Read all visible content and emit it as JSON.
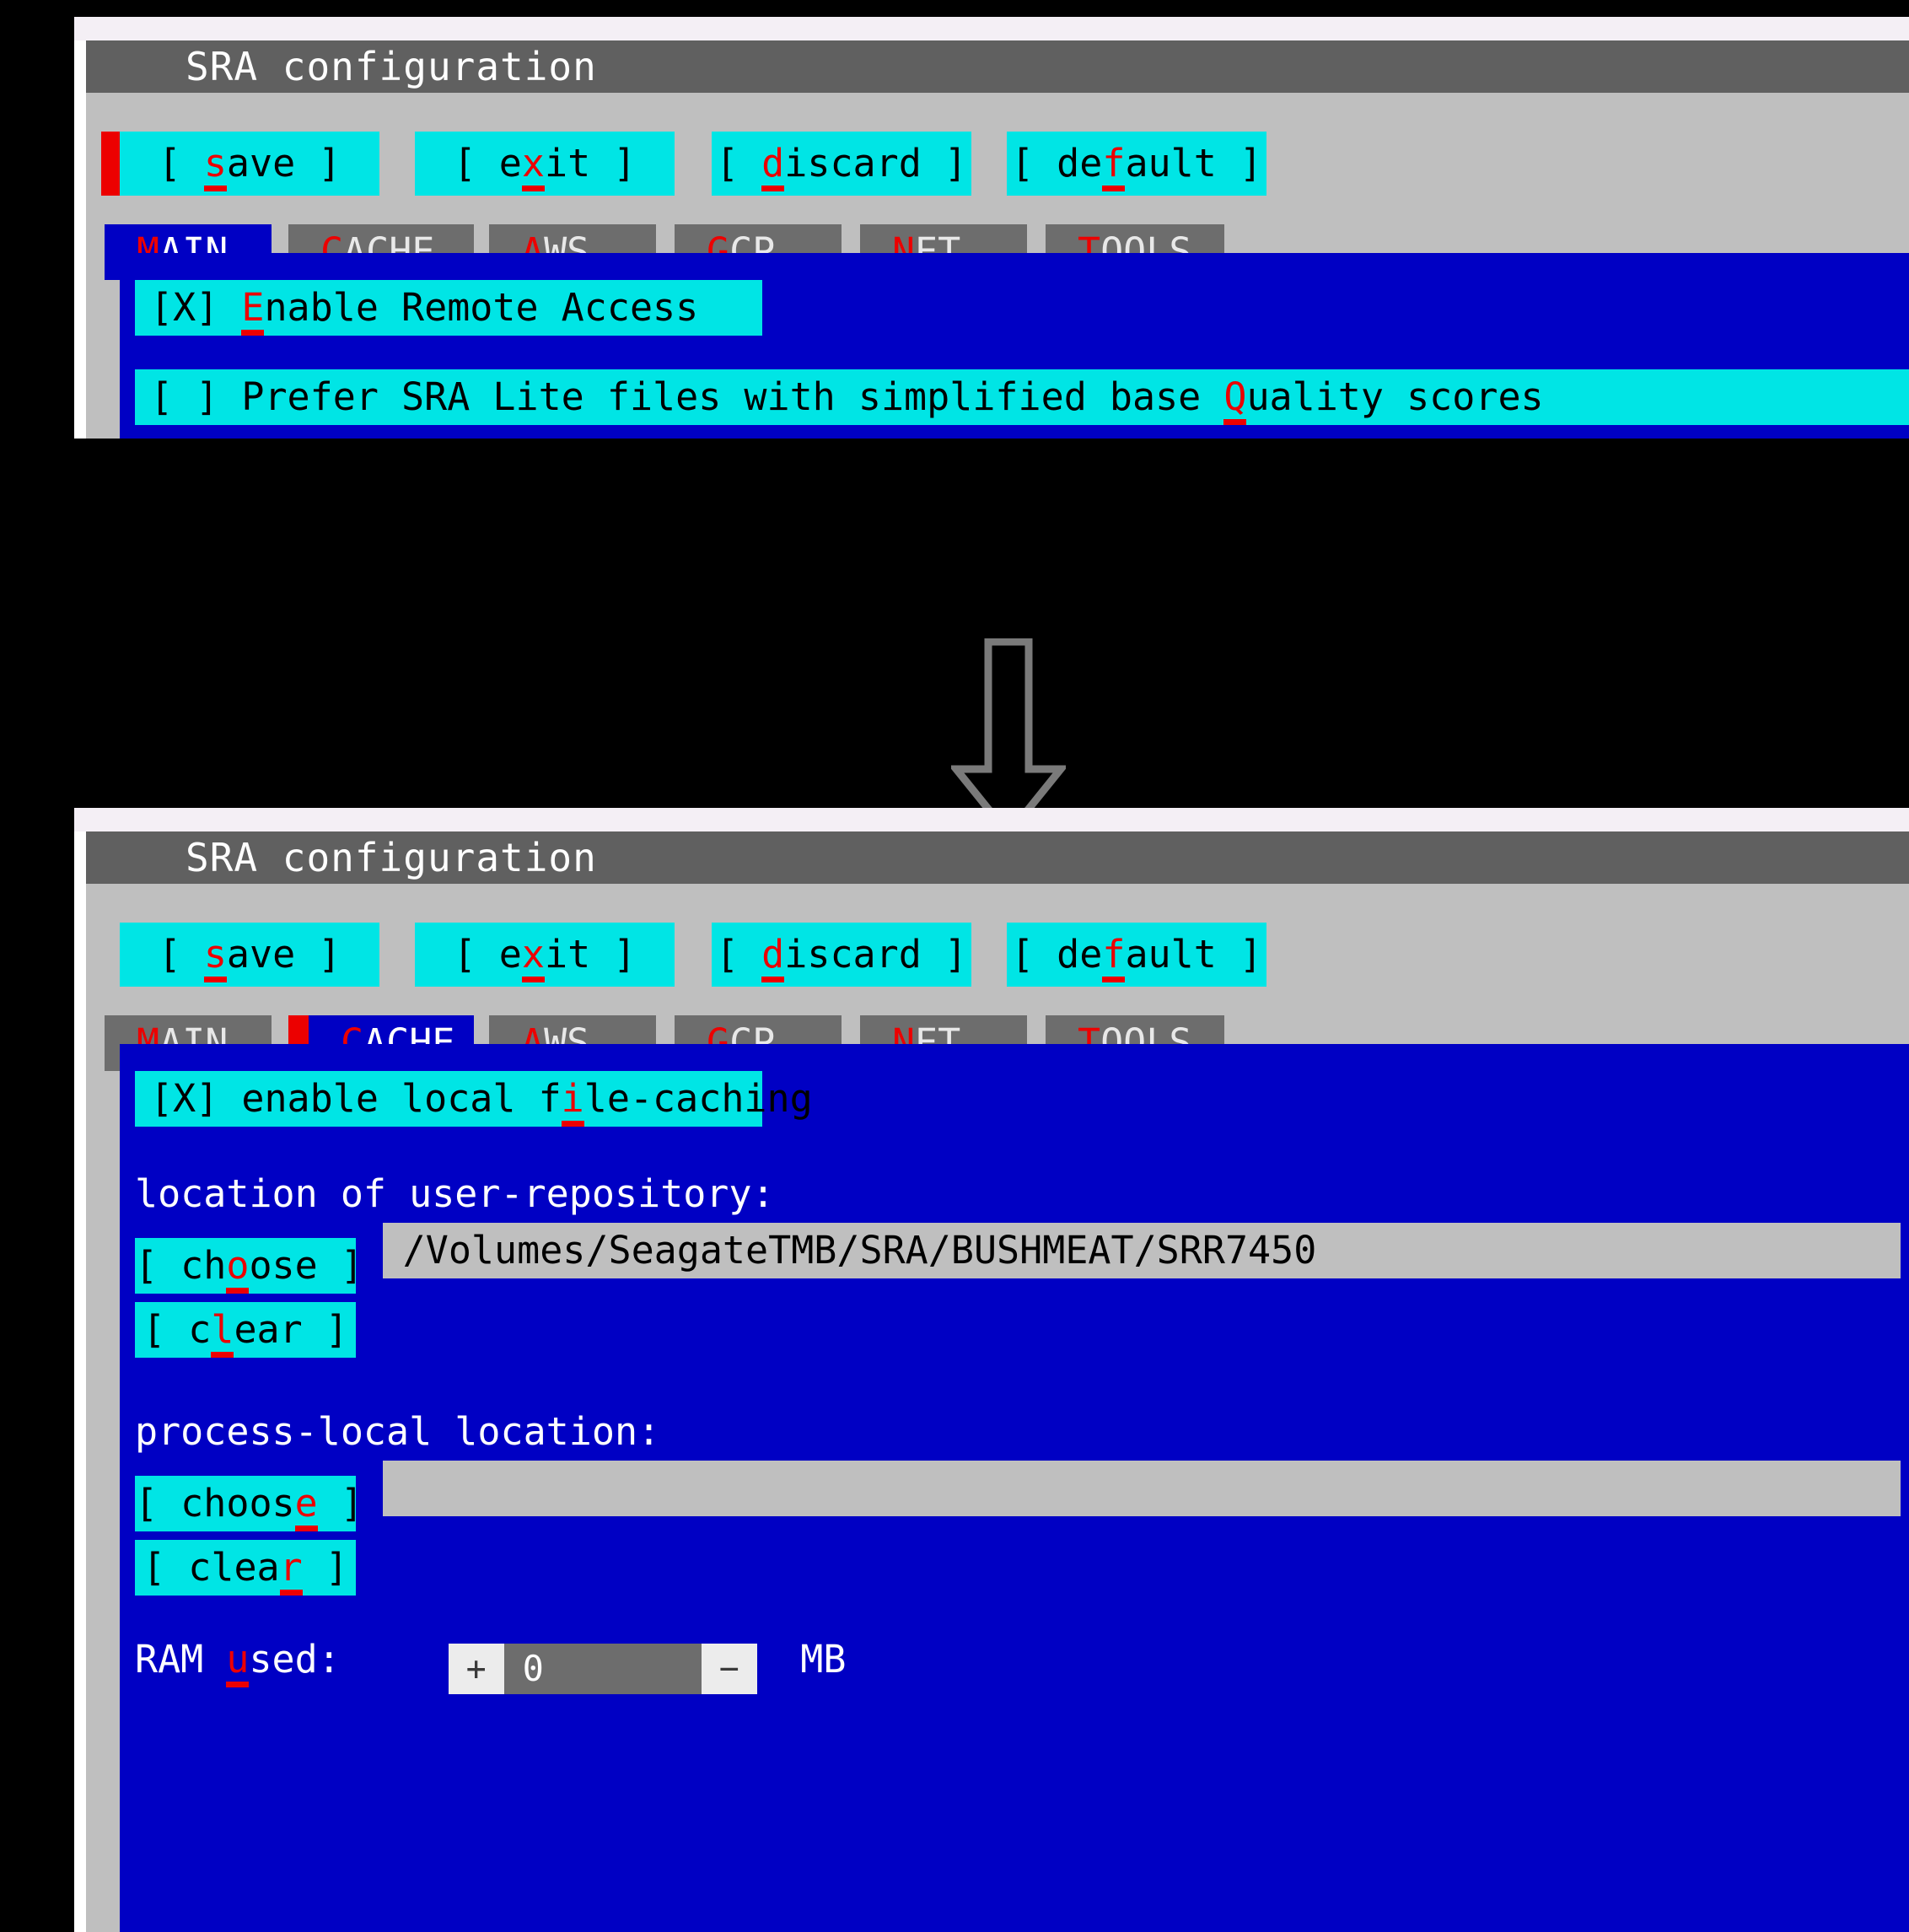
{
  "colors": {
    "titlebar": "#606060",
    "window_body": "#bfbfbf",
    "panel_blue": "#0000c4",
    "widget_cyan": "#00e5e5",
    "accent_red": "#ec0000",
    "tab_inactive": "#6d6d6d",
    "field_gray": "#bfbfbf",
    "background": "#000000"
  },
  "panel_top": {
    "title": "SRA configuration",
    "toolbar": {
      "cursor_on": "save",
      "buttons": [
        {
          "text_before": "[   ",
          "acc": "s",
          "text_after": "ave     ]",
          "name": "save"
        },
        {
          "text_before": "[   e",
          "acc": "x",
          "text_after": "it    ]",
          "name": "exit"
        },
        {
          "text_before": "[ ",
          "acc": "d",
          "text_after": "iscard  ]",
          "name": "discard"
        },
        {
          "text_before": "[ de",
          "acc": "f",
          "text_after": "ault   ]",
          "name": "default"
        }
      ]
    },
    "tabs": [
      {
        "acc": "M",
        "rest": "AIN",
        "active": true
      },
      {
        "acc": "C",
        "rest": "ACHE",
        "active": false
      },
      {
        "acc": "A",
        "rest": "WS",
        "active": false
      },
      {
        "acc": "G",
        "rest": "CP",
        "active": false
      },
      {
        "acc": "N",
        "rest": "ET",
        "active": false
      },
      {
        "acc": "T",
        "rest": "OOLS",
        "active": false
      }
    ],
    "checkboxes": [
      {
        "box": "[X]",
        "text_before": " ",
        "acc": "E",
        "text_after": "nable Remote Access"
      },
      {
        "box": "[ ]",
        "text_before": " Prefer SRA Lite files with simplified base ",
        "acc": "Q",
        "text_after": "uality scores"
      }
    ]
  },
  "panel_bottom": {
    "title": "SRA configuration",
    "toolbar": {
      "cursor_on": "none",
      "buttons": [
        {
          "text_before": "[   ",
          "acc": "s",
          "text_after": "ave     ]",
          "name": "save"
        },
        {
          "text_before": "[   e",
          "acc": "x",
          "text_after": "it    ]",
          "name": "exit"
        },
        {
          "text_before": "[ ",
          "acc": "d",
          "text_after": "iscard  ]",
          "name": "discard"
        },
        {
          "text_before": "[ de",
          "acc": "f",
          "text_after": "ault   ]",
          "name": "default"
        }
      ]
    },
    "tabs": [
      {
        "acc": "M",
        "rest": "AIN",
        "active": false
      },
      {
        "acc": "C",
        "rest": "ACHE",
        "active": true
      },
      {
        "acc": "A",
        "rest": "WS",
        "active": false
      },
      {
        "acc": "G",
        "rest": "CP",
        "active": false
      },
      {
        "acc": "N",
        "rest": "ET",
        "active": false
      },
      {
        "acc": "T",
        "rest": "OOLS",
        "active": false
      }
    ],
    "enable_cache": {
      "box": "[X]",
      "text_before": " enable local f",
      "acc": "i",
      "text_after": "le-caching"
    },
    "user_repo": {
      "label": "location of user-repository:",
      "choose": {
        "text_before": "[ ch",
        "acc": "o",
        "text_after": "ose ]"
      },
      "value": "/Volumes/SeagateTMB/SRA/BUSHMEAT/SRR7450",
      "clear": {
        "text_before": "[ c",
        "acc": "l",
        "text_after": "ear   ]"
      }
    },
    "process_local": {
      "label": "process-local location:",
      "choose": {
        "text_before": "[ choos",
        "acc": "e",
        "text_after": " ]"
      },
      "value": "",
      "clear": {
        "text_before": "[ clea",
        "acc": "r",
        "text_after": "   ]"
      }
    },
    "ram": {
      "label_before": "RAM ",
      "acc": "u",
      "label_after": "sed:",
      "plus": "+",
      "value": "0",
      "minus": "−",
      "unit": "MB"
    }
  },
  "arrow": {
    "direction": "down",
    "style": "outlined",
    "color": "#7a7a7a"
  }
}
